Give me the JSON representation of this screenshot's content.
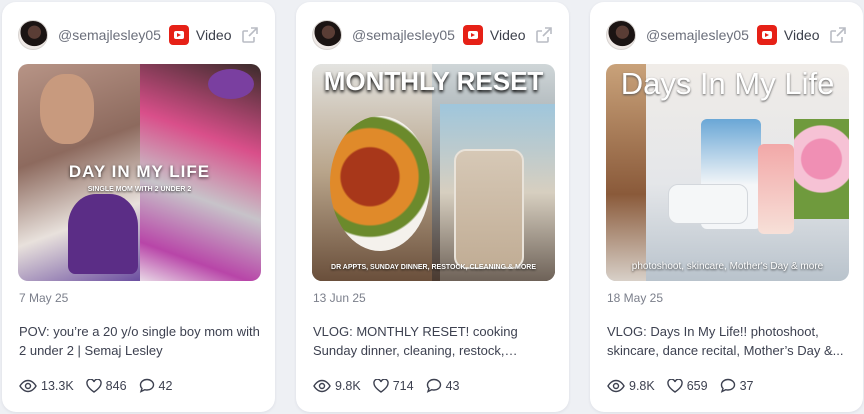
{
  "cards": [
    {
      "username": "@semajlesley05",
      "type_label": "Video",
      "thumbnail": {
        "title": "DAY IN MY LIFE",
        "subtitle": "SINGLE MOM WITH 2 UNDER 2"
      },
      "date": "7 May 25",
      "description": "POV: you’re a 20 y/o single boy mom with 2 under 2 | Semaj Lesley",
      "views": "13.3K",
      "likes": "846",
      "comments": "42"
    },
    {
      "username": "@semajlesley05",
      "type_label": "Video",
      "thumbnail": {
        "title": "MONTHLY RESET",
        "subtitle": "DR APPTS, SUNDAY DINNER, RESTOCK, CLEANING & MORE"
      },
      "date": "13 Jun 25",
      "description": "VLOG: MONTHLY RESET! cooking Sunday dinner, cleaning, restock, appointments ...",
      "views": "9.8K",
      "likes": "714",
      "comments": "43"
    },
    {
      "username": "@semajlesley05",
      "type_label": "Video",
      "thumbnail": {
        "title": "Days In My Life",
        "subtitle": "photoshoot, skincare, Mother's Day & more"
      },
      "date": "18 May 25",
      "description": "VLOG: Days In My Life!! photoshoot, skincare, dance recital, Mother’s Day &...",
      "views": "9.8K",
      "likes": "659",
      "comments": "37"
    }
  ],
  "icons": {
    "platform": "youtube-icon",
    "open": "external-link-icon",
    "views": "eye-icon",
    "likes": "heart-icon",
    "comments": "comment-icon"
  }
}
